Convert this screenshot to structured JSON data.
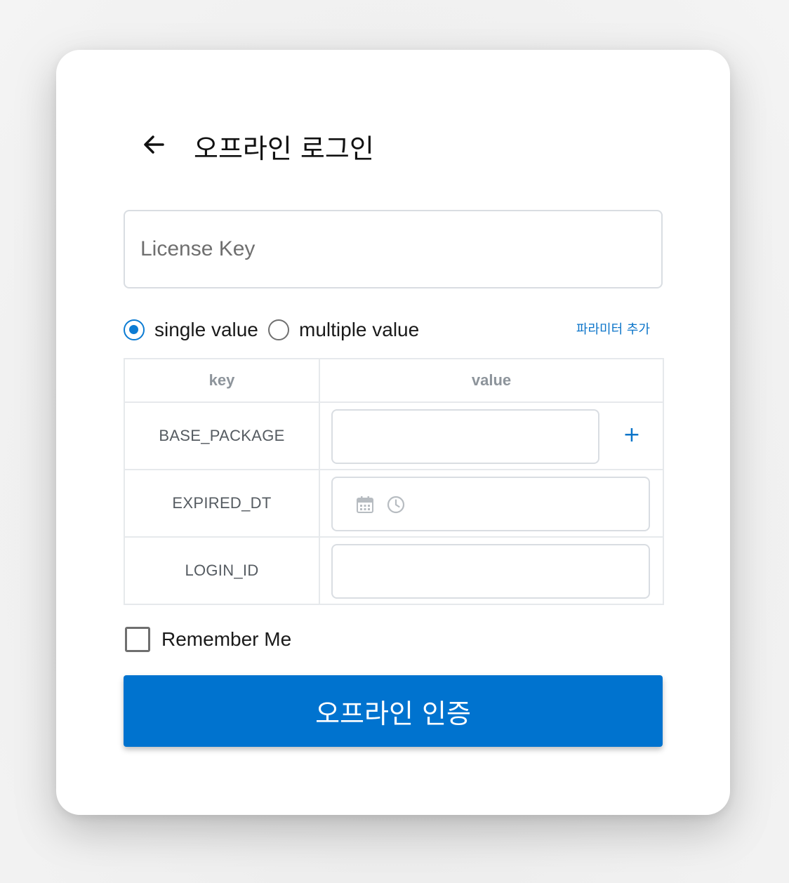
{
  "header": {
    "back_icon": "arrow-left-icon",
    "title": "오프라인 로그인"
  },
  "license": {
    "placeholder": "License Key",
    "value": ""
  },
  "mode": {
    "options": [
      {
        "label": "single value",
        "selected": true
      },
      {
        "label": "multiple value",
        "selected": false
      }
    ],
    "add_parameter_label": "파라미터 추가"
  },
  "params_table": {
    "columns": [
      "key",
      "value"
    ],
    "rows": [
      {
        "key": "BASE_PACKAGE",
        "value": "",
        "has_add_button": true,
        "add_icon": "plus-icon",
        "add_symbol": "+"
      },
      {
        "key": "EXPIRED_DT",
        "value": "",
        "icons": [
          "calendar-icon",
          "clock-icon"
        ]
      },
      {
        "key": "LOGIN_ID",
        "value": ""
      }
    ]
  },
  "remember_me": {
    "label": "Remember Me",
    "checked": false
  },
  "submit": {
    "label": "오프라인 인증"
  },
  "colors": {
    "accent": "#0073cf",
    "link": "#0b74c9",
    "border": "#d9dde2"
  }
}
